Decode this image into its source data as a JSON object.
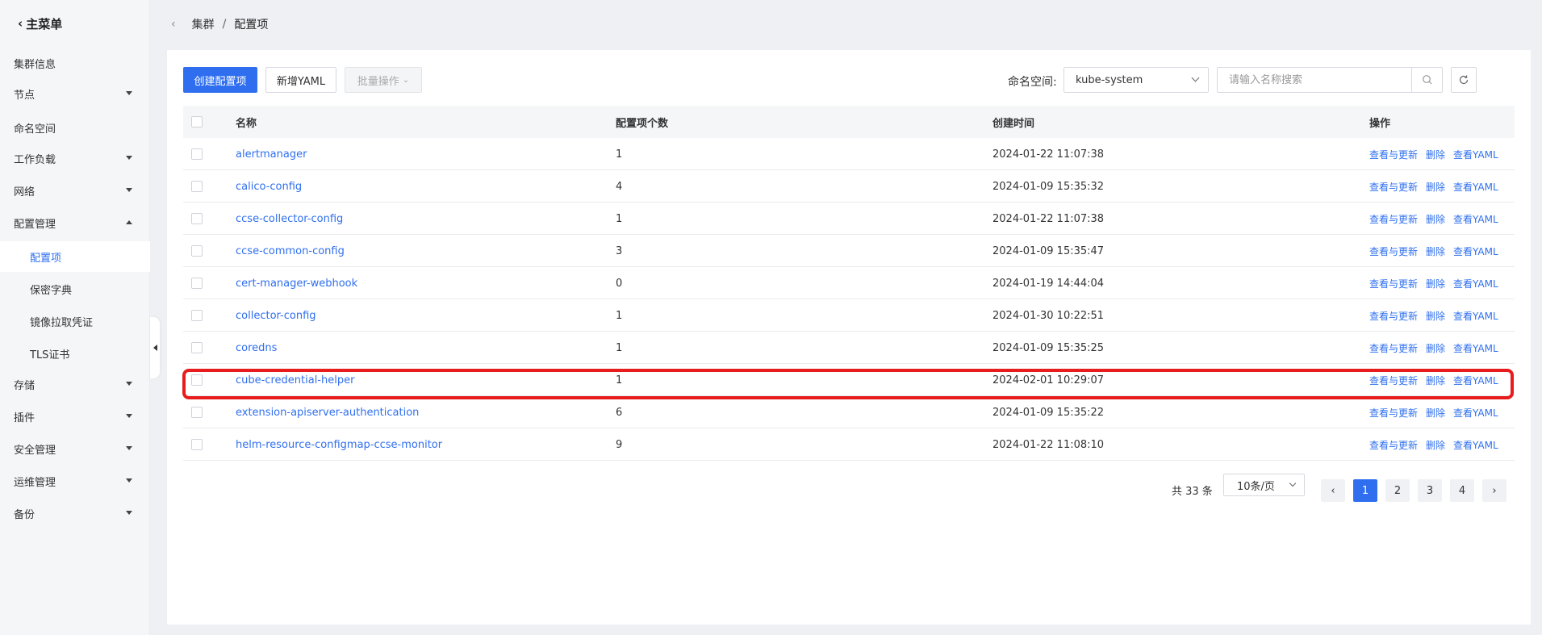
{
  "sidebar": {
    "back_label": "主菜单",
    "items": [
      {
        "label": "集群信息"
      },
      {
        "label": "节点"
      },
      {
        "label": "命名空间"
      },
      {
        "label": "工作负载"
      },
      {
        "label": "网络"
      },
      {
        "label": "配置管理"
      },
      {
        "label": "配置项"
      },
      {
        "label": "保密字典"
      },
      {
        "label": "镜像拉取凭证"
      },
      {
        "label": "TLS证书"
      },
      {
        "label": "存储"
      },
      {
        "label": "插件"
      },
      {
        "label": "安全管理"
      },
      {
        "label": "运维管理"
      },
      {
        "label": "备份"
      }
    ]
  },
  "breadcrumb": {
    "parent": "集群",
    "separator": "/",
    "current": "配置项"
  },
  "toolbar": {
    "create_label": "创建配置项",
    "yaml_label": "新增YAML",
    "batch_label": "批量操作",
    "namespace_label": "命名空间:",
    "namespace_value": "kube-system",
    "search_placeholder": "请输入名称搜索"
  },
  "table": {
    "columns": {
      "name": "名称",
      "count": "配置项个数",
      "time": "创建时间",
      "ops": "操作"
    },
    "ops": {
      "view": "查看与更新",
      "delete": "删除",
      "yaml": "查看YAML"
    },
    "rows": [
      {
        "name": "alertmanager",
        "count": "1",
        "time": "2024-01-22 11:07:38"
      },
      {
        "name": "calico-config",
        "count": "4",
        "time": "2024-01-09 15:35:32"
      },
      {
        "name": "ccse-collector-config",
        "count": "1",
        "time": "2024-01-22 11:07:38"
      },
      {
        "name": "ccse-common-config",
        "count": "3",
        "time": "2024-01-09 15:35:47"
      },
      {
        "name": "cert-manager-webhook",
        "count": "0",
        "time": "2024-01-19 14:44:04"
      },
      {
        "name": "collector-config",
        "count": "1",
        "time": "2024-01-30 10:22:51"
      },
      {
        "name": "coredns",
        "count": "1",
        "time": "2024-01-09 15:35:25"
      },
      {
        "name": "cube-credential-helper",
        "count": "1",
        "time": "2024-02-01 10:29:07"
      },
      {
        "name": "extension-apiserver-authentication",
        "count": "6",
        "time": "2024-01-09 15:35:22"
      },
      {
        "name": "helm-resource-configmap-ccse-monitor",
        "count": "9",
        "time": "2024-01-22 11:08:10"
      }
    ]
  },
  "pagination": {
    "total": "共 33 条",
    "page_size": "10条/页",
    "pages": [
      "1",
      "2",
      "3",
      "4"
    ],
    "current": "1"
  },
  "colors": {
    "accent": "#2f6fef",
    "highlight": "#e81c1c"
  }
}
